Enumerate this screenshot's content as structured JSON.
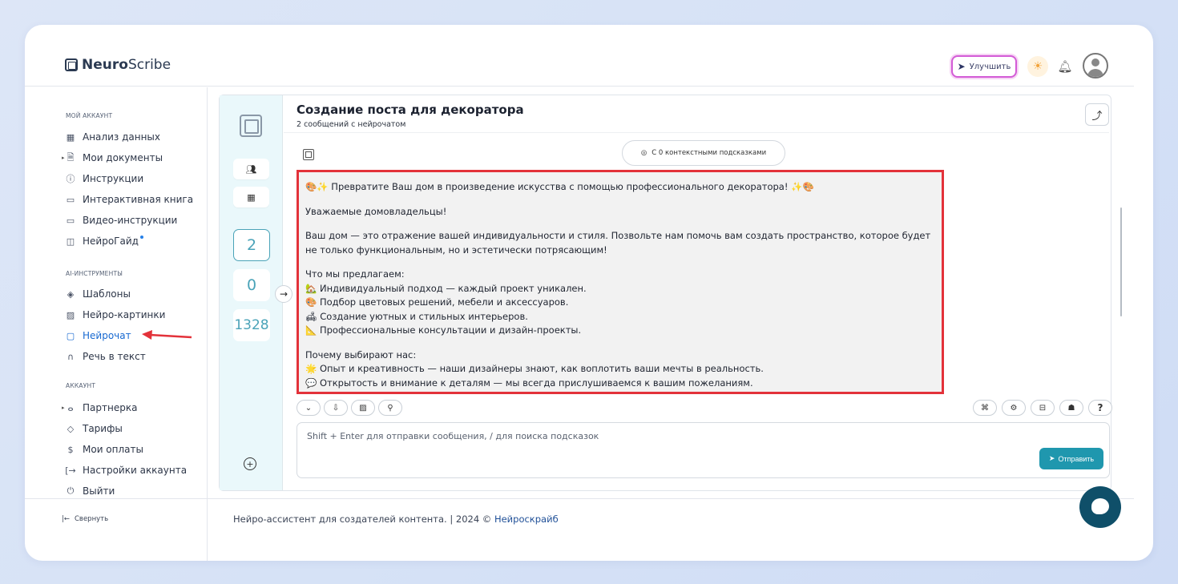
{
  "header": {
    "logo_bold": "Neuro",
    "logo_light": "Scribe",
    "upgrade_label": "Улучшить"
  },
  "sidebar": {
    "sections": {
      "account": "МОЙ АККАУНТ",
      "ai_tools": "AI-ИНСТРУМЕНТЫ",
      "acc": "АККАУНТ"
    },
    "account_items": [
      {
        "label": "Анализ данных",
        "icon": "grid-icon"
      },
      {
        "label": "Мои документы",
        "icon": "document-icon"
      },
      {
        "label": "Инструкции",
        "icon": "help-circle-icon"
      },
      {
        "label": "Интерактивная книга",
        "icon": "book-icon"
      },
      {
        "label": "Видео-инструкции",
        "icon": "video-icon"
      },
      {
        "label": "НейроГайд",
        "icon": "guide-icon"
      }
    ],
    "ai_items": [
      {
        "label": "Шаблоны",
        "icon": "layers-icon"
      },
      {
        "label": "Нейро-картинки",
        "icon": "image-icon"
      },
      {
        "label": "Нейрочат",
        "icon": "chat-icon"
      },
      {
        "label": "Речь в текст",
        "icon": "headphones-icon"
      }
    ],
    "acc_items": [
      {
        "label": "Партнерка",
        "icon": "users-icon"
      },
      {
        "label": "Тарифы",
        "icon": "tag-icon"
      },
      {
        "label": "Мои оплаты",
        "icon": "dollar-icon"
      },
      {
        "label": "Настройки аккаунта",
        "icon": "login-icon"
      },
      {
        "label": "Выйти",
        "icon": "power-icon"
      }
    ],
    "collapse_label": "Свернуть"
  },
  "rail": {
    "counters": [
      "2",
      "0",
      "1328"
    ]
  },
  "chat": {
    "title": "Создание поста для декоратора",
    "subtitle": "2 сообщений с нейрочатом",
    "hints_label": "С 0 контекстными подсказками",
    "message": {
      "headline": "🎨✨ Превратите Ваш дом в произведение искусства с помощью профессионального декоратора! ✨🎨",
      "greeting": "Уважаемые домовладельцы!",
      "intro": "Ваш дом — это отражение вашей индивидуальности и стиля. Позвольте нам помочь вам создать пространство, которое будет не только функциональным, но и эстетически потрясающим!",
      "offer_title": "Что мы предлагаем:",
      "offer_items": [
        "🏡 Индивидуальный подход — каждый проект уникален.",
        "🎨 Подбор цветовых решений, мебели и аксессуаров.",
        "🛋 Создание уютных и стильных интерьеров.",
        "📐 Профессиональные консультации и дизайн-проекты."
      ],
      "why_title": "Почему выбирают нас:",
      "why_items": [
        "🌟 Опыт и креативность — наши дизайнеры знают, как воплотить ваши мечты в реальность.",
        "💬 Открытость и внимание к деталям — мы всегда прислушиваемся к вашим пожеланиям."
      ]
    },
    "input_placeholder": "Shift + Enter для отправки сообщения, / для поиска подсказок",
    "send_label": "Отправить"
  },
  "footer": {
    "text": "Нейро-ассистент для создателей контента.  | 2024 © ",
    "link": "Нейроскрайб"
  }
}
